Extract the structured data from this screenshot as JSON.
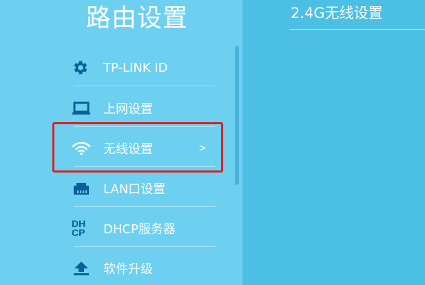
{
  "sidebar": {
    "title": "路由设置",
    "items": [
      {
        "label": "TP-LINK ID",
        "icon": "gear-icon"
      },
      {
        "label": "上网设置",
        "icon": "laptop-icon"
      },
      {
        "label": "无线设置",
        "icon": "wifi-icon",
        "chevron": ">",
        "selected": true
      },
      {
        "label": "LAN口设置",
        "icon": "lan-port-icon"
      },
      {
        "label": "DHCP服务器",
        "icon": "dhcp-icon",
        "icon_text_top": "DH",
        "icon_text_bottom": "CP"
      },
      {
        "label": "软件升级",
        "icon": "upload-icon"
      }
    ]
  },
  "panel": {
    "title": "2.4G无线设置"
  },
  "colors": {
    "sidebar_bg": "#6dd0f0",
    "panel_bg": "#4cc0e4",
    "icon": "#0b5f97",
    "highlight": "#e01e1e"
  }
}
